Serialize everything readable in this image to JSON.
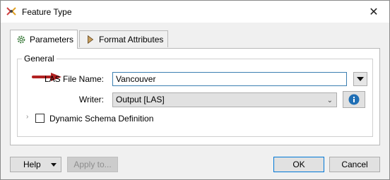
{
  "window": {
    "title": "Feature Type"
  },
  "tabs": [
    {
      "label": "Parameters",
      "icon": "gear-icon"
    },
    {
      "label": "Format Attributes",
      "icon": "arrow-right-icon"
    }
  ],
  "general": {
    "legend": "General",
    "las_file_name": {
      "label": "LAS File Name:",
      "value": "Vancouver"
    },
    "writer": {
      "label": "Writer:",
      "value": "Output [LAS]"
    },
    "dynamic_schema": {
      "label": "Dynamic Schema Definition",
      "checked": false
    }
  },
  "footer": {
    "help_label": "Help",
    "apply_label": "Apply to...",
    "ok_label": "OK",
    "cancel_label": "Cancel"
  },
  "colors": {
    "annotation_arrow": "#b22222",
    "info_icon": "#1f6fb5",
    "focus_border": "#0078d7"
  }
}
